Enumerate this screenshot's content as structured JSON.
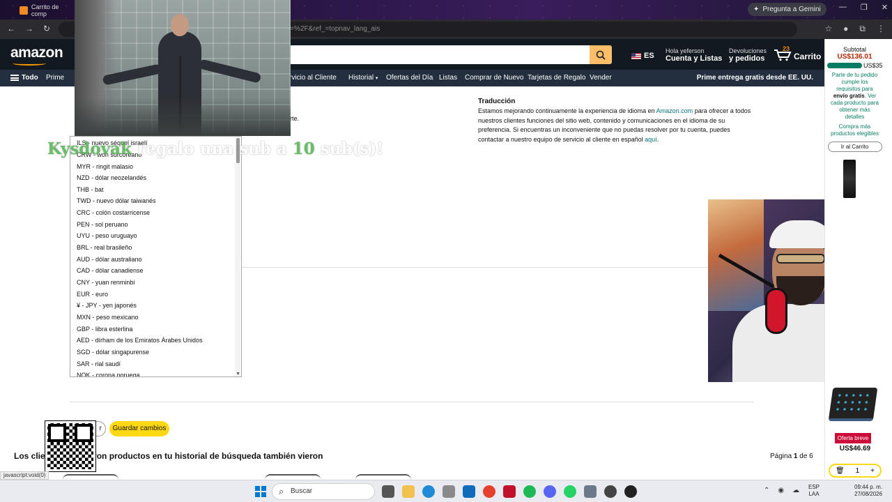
{
  "browser": {
    "tab_title": "Carrito de comp",
    "url_fragment": "l=%2F&ref_=topnav_lang_ais",
    "gemini_label": "Pregunta a Gemini"
  },
  "header": {
    "logo": "amazon",
    "language": "ES",
    "account_greeting": "Hola yeferson",
    "account_label": "Cuenta y Listas",
    "orders_top": "Devoluciones",
    "orders_bottom": "y pedidos",
    "cart_count": "23",
    "cart_label": "Carrito"
  },
  "nav": {
    "menu_label": "Todo",
    "items": [
      "Prime",
      "rvicio al Cliente",
      "Historial",
      "Ofertas del Día",
      "Listas",
      "Comprar de Nuevo",
      "Tarjetas de Regalo",
      "Vender"
    ],
    "promo": "Prime entrega gratis desde EE. UU."
  },
  "translation": {
    "title": "Traducción",
    "body_1": "Estamos mejorando continuamente la experiencia de idioma en ",
    "link_1": "Amazon.com",
    "body_2": " para ofrecer a todos nuestros clientes funciones del sitio web, contenido y comunicaciones en el idioma de su preferencia. Si encuentras un inconveniente que no puedas resolver por tu cuenta, puedes contactar a nuestro equipo de servicio al cliente en español ",
    "link_2": "aquí",
    "body_3": "."
  },
  "partial_text": "rte.",
  "currency_list": [
    "ILS - nuevo séquel israelí",
    "CRW - won surcoreano",
    "MYR - ringit malasio",
    "NZD - dólar neozelandés",
    "THB - bat",
    "TWD - nuevo dólar taiwanés",
    "CRC - colón costarricense",
    "PEN - sol peruano",
    "UYU - peso uruguayo",
    "BRL - real brasileño",
    "AUD - dólar australiano",
    "CAD - dólar canadiense",
    "CNY - yuan renminbi",
    "EUR - euro",
    "¥ - JPY - yen japonés",
    "MXN - peso mexicano",
    "GBP - libra esterlina",
    "AED - dírham de los Emiratos Árabes Unidos",
    "SGD - dólar singapurense",
    "SAR - rial saudí",
    "NOK - corona noruega"
  ],
  "stream_alert": {
    "user": "Kysdovak",
    "text": " regalo una sub a ",
    "count": "10",
    "suffix": " sub(s)!"
  },
  "actions": {
    "cancel": "r",
    "save": "Guardar cambios"
  },
  "related": {
    "title": "Los clientes que vieron productos en tu historial de búsqueda también vieron",
    "page_prefix": "Página ",
    "page_current": "1",
    "page_suffix": " de 6"
  },
  "cart_sidebar": {
    "subtotal_label": "Subtotal",
    "subtotal": "US$136.01",
    "threshold": "US$35",
    "msg_1": "Parte de tu pedido cumple los requisitos para ",
    "msg_bold": "envío gratis",
    "msg_2": ". Ver cada producto para obtener más detalles",
    "msg_3": "Compra más productos elegibles",
    "button": "Ir al Carrito",
    "deal_badge": "Oferta breve",
    "deal_price": "US$46.69",
    "qty": "1"
  },
  "status_bar": "javascript:void(0)",
  "taskbar": {
    "search": "Buscar",
    "lang_top": "ESP",
    "lang_bottom": "LAA",
    "time": "09:44 p. m.",
    "date": "27/08/2026"
  },
  "colors": {
    "amazon_dark": "#131921",
    "amazon_nav": "#232f3e",
    "accent_yellow": "#ffd814",
    "link": "#007185",
    "price_red": "#b12704"
  }
}
